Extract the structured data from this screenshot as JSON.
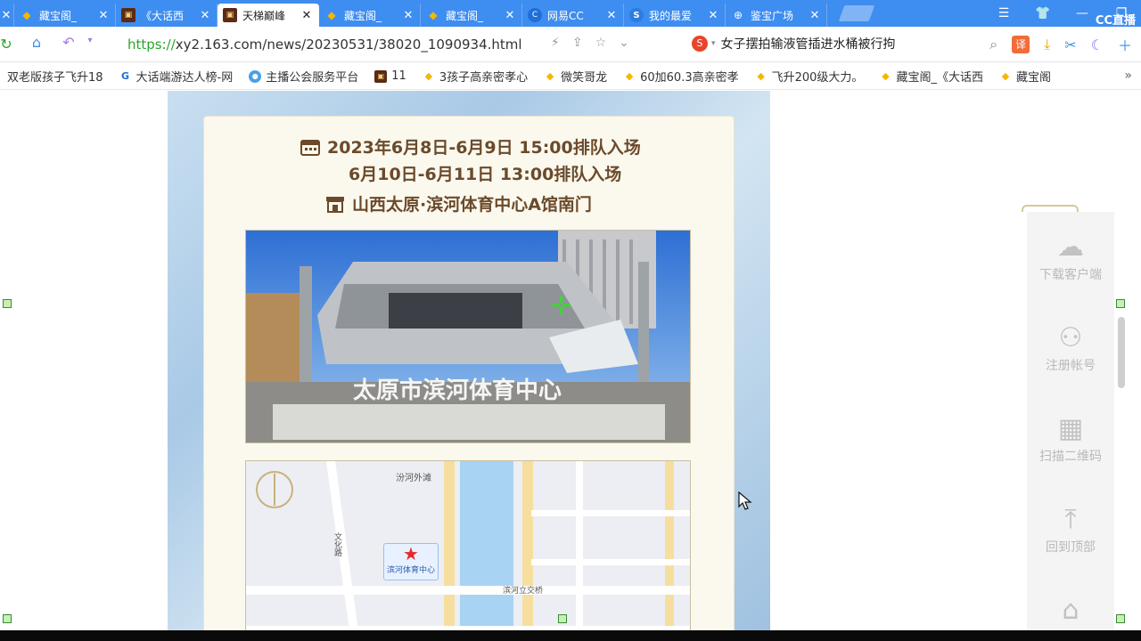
{
  "tabs": [
    {
      "title": "",
      "icon": "partial-tab",
      "active": false
    },
    {
      "title": "藏宝阁_",
      "icon": "coin-icon",
      "active": false
    },
    {
      "title": "《大话西",
      "icon": "game-icon",
      "active": false
    },
    {
      "title": "天梯巅峰",
      "icon": "game-icon",
      "active": true
    },
    {
      "title": "藏宝阁_",
      "icon": "coin-icon",
      "active": false
    },
    {
      "title": "藏宝阁_",
      "icon": "coin-icon",
      "active": false
    },
    {
      "title": "网易CC",
      "icon": "cc-icon",
      "active": false
    },
    {
      "title": "我的最爱",
      "icon": "s-icon",
      "active": false
    },
    {
      "title": "鉴宝广场",
      "icon": "globe-icon",
      "active": false
    }
  ],
  "tab_close": "✕",
  "window": {
    "menu": "☰",
    "skin": "👕",
    "minimize": "—",
    "restore": "❐",
    "brand": "CC直播"
  },
  "address": {
    "url_proto": "https://",
    "url_rest": "xy2.163.com/news/20230531/38020_1090934.html",
    "news_headline": "女子摆拍输液管插进水桶被行拘"
  },
  "bookmarks": [
    {
      "label": "双老版孩子飞升18",
      "icon": "coin"
    },
    {
      "label": "大话端游达人榜-网",
      "icon": "g"
    },
    {
      "label": "主播公会服务平台",
      "icon": "ball"
    },
    {
      "label": "11",
      "icon": "game"
    },
    {
      "label": "3孩子高亲密孝心",
      "icon": "coin"
    },
    {
      "label": "微笑哥龙",
      "icon": "coin"
    },
    {
      "label": "60加60.3高亲密孝",
      "icon": "coin"
    },
    {
      "label": "飞升200级大力。",
      "icon": "coin"
    },
    {
      "label": "藏宝阁_《大话西",
      "icon": "coin"
    },
    {
      "label": "藏宝阁",
      "icon": "coin"
    }
  ],
  "event": {
    "date_line_1": "2023年6月8日-6月9日 15:00排队入场",
    "date_line_2": "6月10日-6月11日 13:00排队入场",
    "location": "山西太原·滨河体育中心A馆南门",
    "venue_sign": "太原市滨河体育中心"
  },
  "map": {
    "label_top": "汾河外滩",
    "label_street": "文化路",
    "label_bridge": "滨河立交桥",
    "marker": "滨河体育中心"
  },
  "float_menu": [
    {
      "label": "下载客户端",
      "icon": "cloud-download-icon"
    },
    {
      "label": "注册帐号",
      "icon": "user-add-icon"
    },
    {
      "label": "扫描二维码",
      "icon": "qrcode-icon"
    },
    {
      "label": "回到顶部",
      "icon": "back-to-top-icon"
    },
    {
      "label": "",
      "icon": "home-icon"
    }
  ]
}
